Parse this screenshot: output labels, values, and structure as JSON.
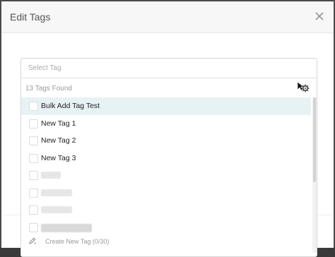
{
  "modal": {
    "title": "Edit Tags",
    "search": {
      "placeholder": "Select Tag"
    },
    "found_text": "13 Tags Found",
    "items": [
      {
        "label": "Bulk Add Tag Test"
      },
      {
        "label": "New Tag 1"
      },
      {
        "label": "New Tag 2"
      },
      {
        "label": "New Tag 3"
      }
    ],
    "create_label": "Create New Tag (0/30)"
  },
  "icons": {
    "close": "close-icon",
    "gear": "gear-icon",
    "pencil": "pencil-icon"
  },
  "colors": {
    "highlight": "#e7f2f4",
    "muted_text": "#9a9a9a"
  }
}
